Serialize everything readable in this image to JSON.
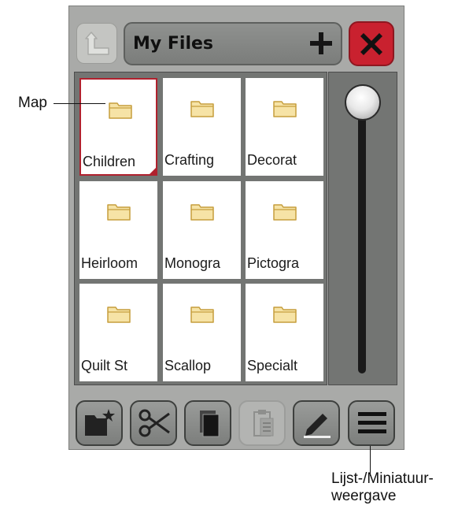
{
  "header": {
    "title": "My Files",
    "add_symbol": "+"
  },
  "files": [
    {
      "label": "Children",
      "selected": true
    },
    {
      "label": "Crafting",
      "selected": false
    },
    {
      "label": "Decorat",
      "selected": false
    },
    {
      "label": "Heirloom",
      "selected": false
    },
    {
      "label": "Monogra",
      "selected": false
    },
    {
      "label": "Pictogra",
      "selected": false
    },
    {
      "label": "Quilt St",
      "selected": false
    },
    {
      "label": "Scallop",
      "selected": false
    },
    {
      "label": "Specialt",
      "selected": false
    }
  ],
  "toolbar": {
    "buttons": [
      {
        "icon": "new-folder-icon",
        "enabled": true
      },
      {
        "icon": "scissors-icon",
        "enabled": true
      },
      {
        "icon": "copy-icon",
        "enabled": true
      },
      {
        "icon": "paste-icon",
        "enabled": false
      },
      {
        "icon": "pencil-icon",
        "enabled": true
      },
      {
        "icon": "list-view-icon",
        "enabled": true
      }
    ]
  },
  "scroll": {
    "position": 0
  },
  "callouts": {
    "map_label": "Map",
    "view_label_line1": "Lijst-/Miniatuur-",
    "view_label_line2": "weergave"
  },
  "colors": {
    "close": "#c9212f",
    "folder": "#f6e3a6",
    "selection": "#b0212e"
  }
}
